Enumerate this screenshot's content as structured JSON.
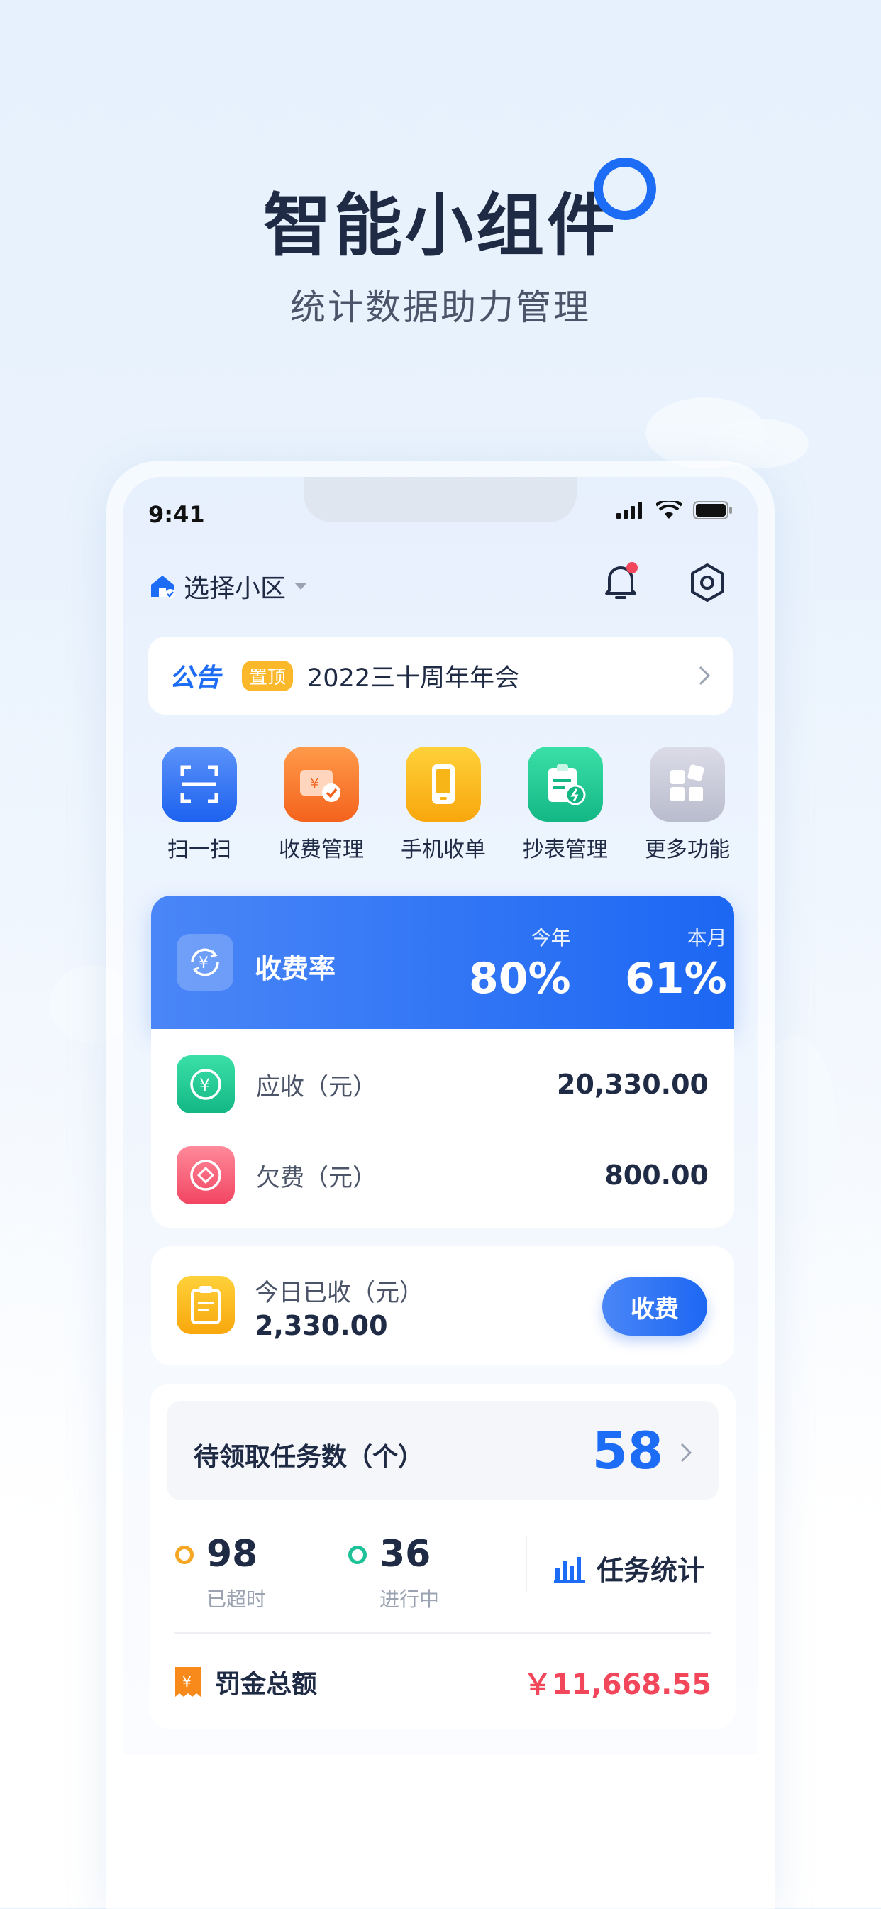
{
  "headline": {
    "title": "智能小组件",
    "subtitle": "统计数据助力管理"
  },
  "status_bar": {
    "time": "9:41"
  },
  "top_bar": {
    "community_label": "选择小区"
  },
  "notice": {
    "tag": "公告",
    "pin": "置顶",
    "text": "2022三十周年年会"
  },
  "quick_actions": [
    {
      "label": "扫一扫",
      "icon": "scan-icon"
    },
    {
      "label": "收费管理",
      "icon": "billing-icon"
    },
    {
      "label": "手机收单",
      "icon": "phone-icon"
    },
    {
      "label": "抄表管理",
      "icon": "meter-icon"
    },
    {
      "label": "更多功能",
      "icon": "more-apps-icon"
    }
  ],
  "collection_rate": {
    "title": "收费率",
    "year_label": "今年",
    "year_value": "80%",
    "month_label": "本月",
    "month_value": "61%"
  },
  "fees": {
    "receivable_label": "应收（元）",
    "receivable_value": "20,330.00",
    "arrears_label": "欠费（元）",
    "arrears_value": "800.00"
  },
  "today": {
    "label": "今日已收（元）",
    "value": "2,330.00",
    "button": "收费"
  },
  "tasks": {
    "pending_label": "待领取任务数（个）",
    "pending_count": "58",
    "overdue_value": "98",
    "overdue_label": "已超时",
    "in_progress_value": "36",
    "in_progress_label": "进行中",
    "stats_link": "任务统计",
    "fine_label": "罚金总额",
    "fine_value": "￥11,668.55"
  },
  "colors": {
    "accent": "#1d6cf5",
    "overdue": "#f5a623",
    "in_progress": "#1ec198",
    "fine": "#f2475a"
  }
}
